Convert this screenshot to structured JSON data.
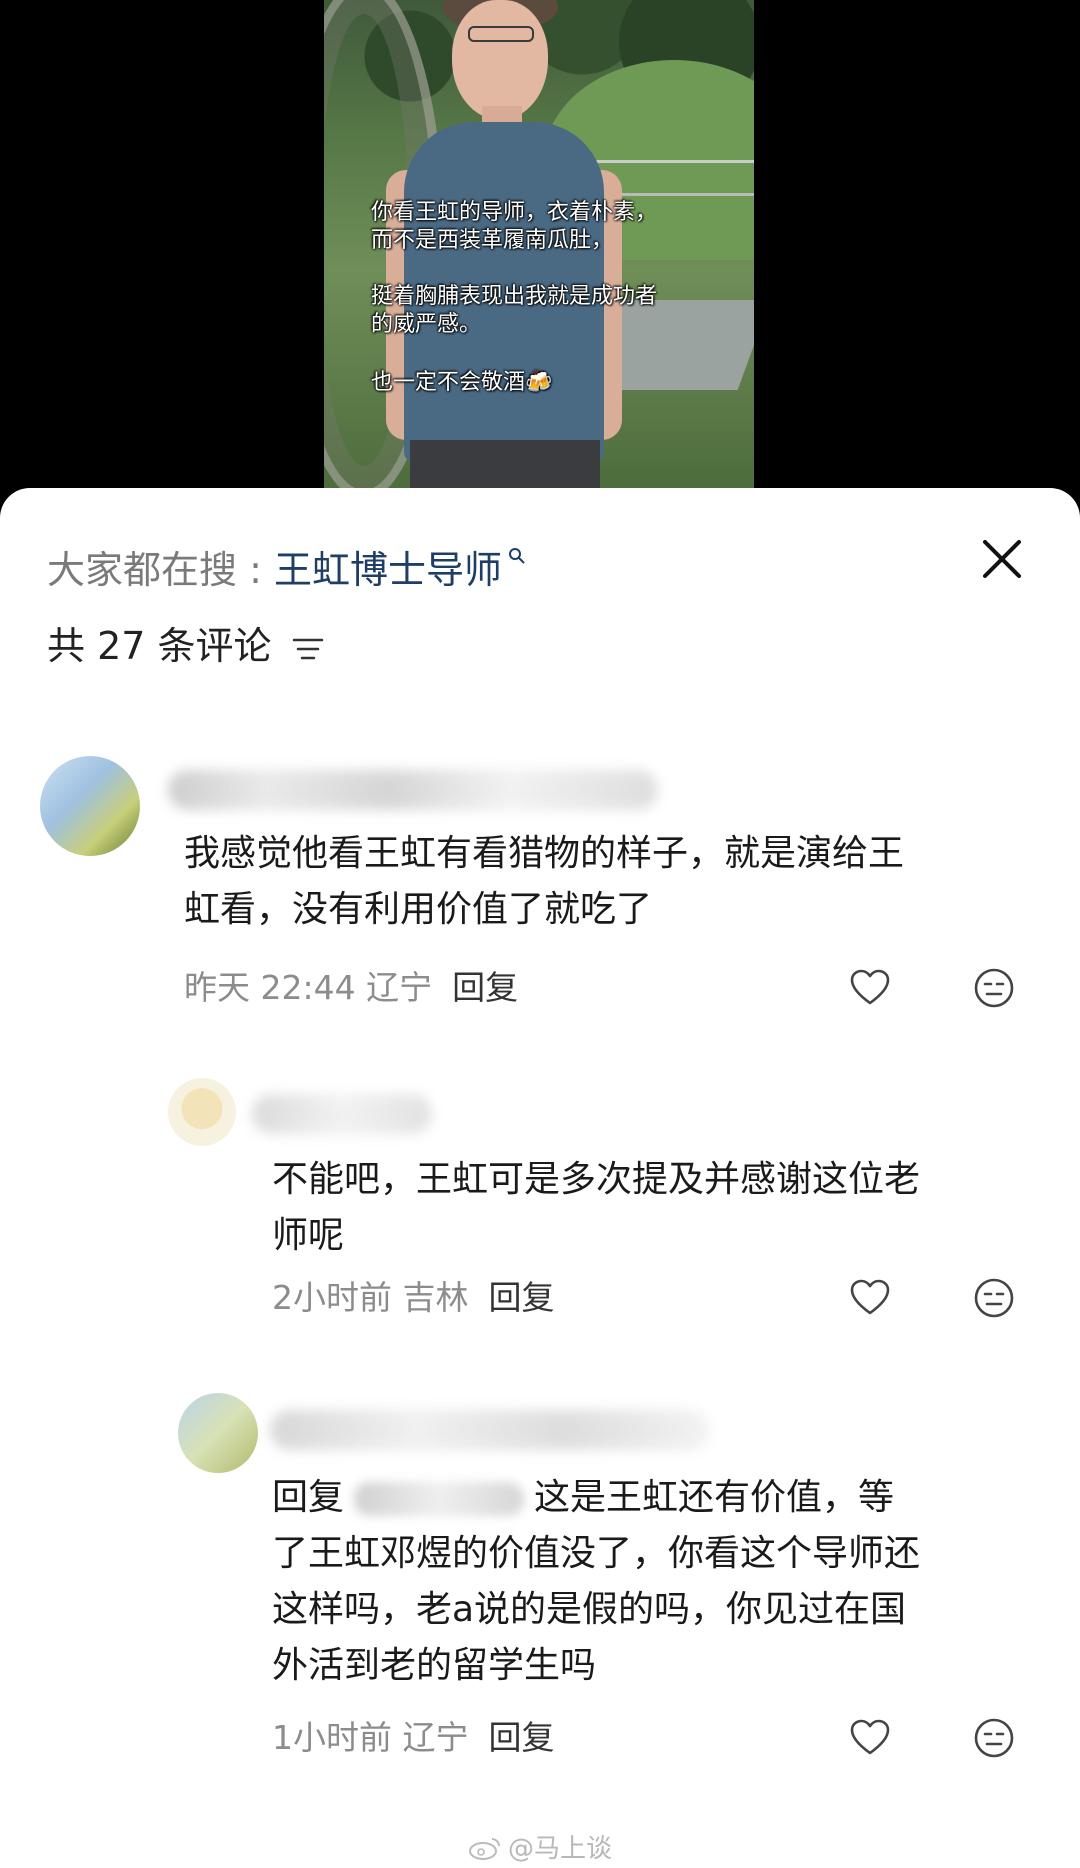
{
  "video": {
    "caption_lines": [
      "你看王虹的导师，衣着朴素，",
      "而不是西装革履南瓜肚，",
      "挺着胸脯表现出我就是成功者",
      "的威严感。",
      "也一定不会敬酒🍻"
    ]
  },
  "header": {
    "search_prefix": "大家都在搜 : ",
    "search_term": "王虹博士导师",
    "comment_count": "共 27 条评论"
  },
  "comments": [
    {
      "text_lines": [
        "我感觉他看王虹有看猎物的样子，就是演给王",
        "虹看，没有利用价值了就吃了"
      ],
      "meta": "昨天 22:44 辽宁",
      "reply_label": "回复"
    },
    {
      "text_lines": [
        "不能吧，王虹可是多次提及并感谢这位老",
        "师呢"
      ],
      "meta": "2小时前 吉林",
      "reply_label": "回复"
    },
    {
      "reply_prefix": "回复",
      "text_first": "这是王虹还有价值，等",
      "text_lines": [
        "了王虹邓煜的价值没了，你看这个导师还",
        "这样吗，老a说的是假的吗，你见过在国",
        "外活到老的留学生吗"
      ],
      "meta": "1小时前 辽宁",
      "reply_label": "回复"
    }
  ],
  "watermark": "@马上谈",
  "icons": {
    "close": "close-icon",
    "sort": "sort-icon",
    "like": "heart-icon",
    "dislike": "neutral-face-icon",
    "search": "search-icon"
  }
}
